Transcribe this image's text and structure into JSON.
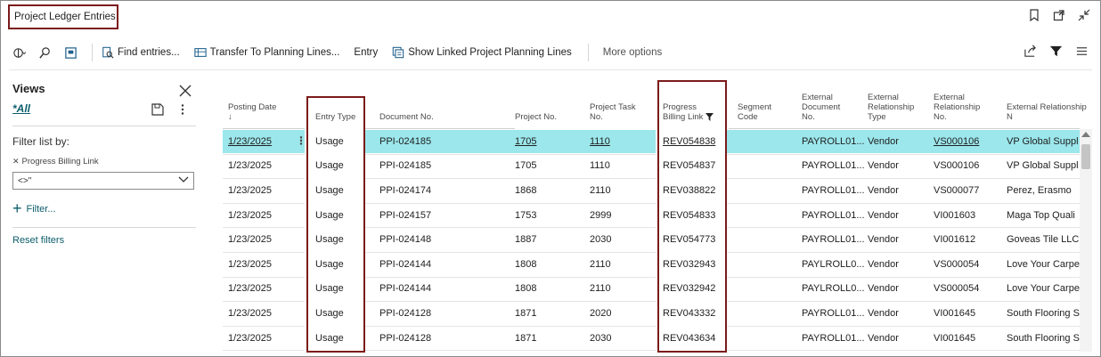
{
  "window": {
    "title": "Project Ledger Entries"
  },
  "toolbar": {
    "find_label": "Find entries...",
    "transfer_label": "Transfer To Planning Lines...",
    "entry_label": "Entry",
    "show_linked_label": "Show Linked Project Planning Lines",
    "more_label": "More options"
  },
  "filter_pane": {
    "views_title": "Views",
    "all_view": "*All",
    "filter_by": "Filter list by:",
    "active_filter": "Progress Billing Link",
    "filter_value": "<>''",
    "add_filter": "Filter...",
    "reset_filters": "Reset filters"
  },
  "table": {
    "headers": {
      "posting_date": [
        "Posting Date",
        "↓"
      ],
      "entry_type": [
        "Entry Type"
      ],
      "document_no": [
        "Document No."
      ],
      "project_no": [
        "Project No."
      ],
      "project_task_no": [
        "Project Task",
        "No."
      ],
      "progress_billing_link": [
        "Progress",
        "Billing Link"
      ],
      "segment_code": [
        "Segment",
        "Code"
      ],
      "external_document_no": [
        "External",
        "Document",
        "No."
      ],
      "external_relationship_type": [
        "External",
        "Relationship",
        "Type"
      ],
      "external_relationship_no": [
        "External",
        "Relationship",
        "No."
      ],
      "external_relationship_name": [
        "External Relationship N"
      ]
    },
    "rows": [
      {
        "posting_date": "1/23/2025",
        "entry_type": "Usage",
        "document_no": "PPI-024185",
        "project_no": "1705",
        "project_task_no": "1110",
        "progress_billing_link": "REV054838",
        "segment_code": "",
        "external_document_no": "PAYROLL01...",
        "external_relationship_type": "Vendor",
        "external_relationship_no": "VS000106",
        "external_relationship_name": "VP Global Suppl"
      },
      {
        "posting_date": "1/23/2025",
        "entry_type": "Usage",
        "document_no": "PPI-024185",
        "project_no": "1705",
        "project_task_no": "1110",
        "progress_billing_link": "REV054837",
        "segment_code": "",
        "external_document_no": "PAYROLL01...",
        "external_relationship_type": "Vendor",
        "external_relationship_no": "VS000106",
        "external_relationship_name": "VP Global Suppl"
      },
      {
        "posting_date": "1/23/2025",
        "entry_type": "Usage",
        "document_no": "PPI-024174",
        "project_no": "1868",
        "project_task_no": "2110",
        "progress_billing_link": "REV038822",
        "segment_code": "",
        "external_document_no": "PAYROLL01...",
        "external_relationship_type": "Vendor",
        "external_relationship_no": "VS000077",
        "external_relationship_name": "Perez, Erasmo"
      },
      {
        "posting_date": "1/23/2025",
        "entry_type": "Usage",
        "document_no": "PPI-024157",
        "project_no": "1753",
        "project_task_no": "2999",
        "progress_billing_link": "REV054833",
        "segment_code": "",
        "external_document_no": "PAYROLL01...",
        "external_relationship_type": "Vendor",
        "external_relationship_no": "VI001603",
        "external_relationship_name": "Maga Top Quali"
      },
      {
        "posting_date": "1/23/2025",
        "entry_type": "Usage",
        "document_no": "PPI-024148",
        "project_no": "1887",
        "project_task_no": "2030",
        "progress_billing_link": "REV054773",
        "segment_code": "",
        "external_document_no": "PAYROLL01...",
        "external_relationship_type": "Vendor",
        "external_relationship_no": "VI001612",
        "external_relationship_name": "Goveas Tile LLC"
      },
      {
        "posting_date": "1/23/2025",
        "entry_type": "Usage",
        "document_no": "PPI-024144",
        "project_no": "1808",
        "project_task_no": "2110",
        "progress_billing_link": "REV032943",
        "segment_code": "",
        "external_document_no": "PAYLROLL0...",
        "external_relationship_type": "Vendor",
        "external_relationship_no": "VS000054",
        "external_relationship_name": "Love Your Carpe"
      },
      {
        "posting_date": "1/23/2025",
        "entry_type": "Usage",
        "document_no": "PPI-024144",
        "project_no": "1808",
        "project_task_no": "2110",
        "progress_billing_link": "REV032942",
        "segment_code": "",
        "external_document_no": "PAYLROLL0...",
        "external_relationship_type": "Vendor",
        "external_relationship_no": "VS000054",
        "external_relationship_name": "Love Your Carpe"
      },
      {
        "posting_date": "1/23/2025",
        "entry_type": "Usage",
        "document_no": "PPI-024128",
        "project_no": "1871",
        "project_task_no": "2020",
        "progress_billing_link": "REV043332",
        "segment_code": "",
        "external_document_no": "PAYROLL01...",
        "external_relationship_type": "Vendor",
        "external_relationship_no": "VI001645",
        "external_relationship_name": "South Flooring S"
      },
      {
        "posting_date": "1/23/2025",
        "entry_type": "Usage",
        "document_no": "PPI-024128",
        "project_no": "1871",
        "project_task_no": "2030",
        "progress_billing_link": "REV043634",
        "segment_code": "",
        "external_document_no": "PAYROLL01...",
        "external_relationship_type": "Vendor",
        "external_relationship_no": "VI001645",
        "external_relationship_name": "South Flooring S"
      }
    ]
  },
  "colors": {
    "accent": "#0b5d6b",
    "selected_row": "#9be7ec",
    "highlight_box": "#7b1a1a"
  }
}
